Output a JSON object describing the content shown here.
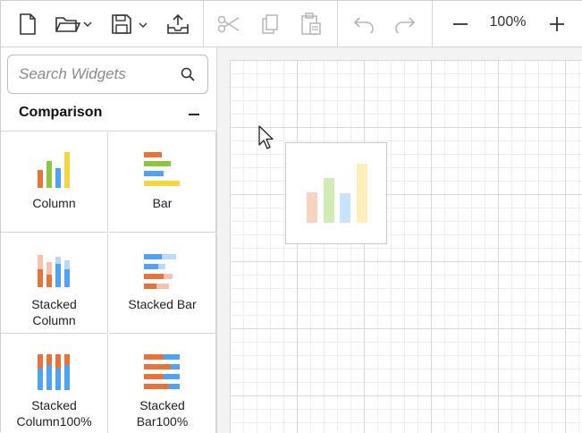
{
  "toolbar": {
    "zoom_value": "100%",
    "icons": [
      "new-file-icon",
      "open-folder-icon",
      "save-icon",
      "export-icon",
      "cut-icon",
      "copy-icon",
      "paste-icon",
      "undo-icon",
      "redo-icon",
      "zoom-out-icon",
      "zoom-in-icon"
    ]
  },
  "palette": {
    "search": {
      "placeholder": "Search Widgets"
    },
    "category": {
      "title": "Comparison"
    },
    "widgets": [
      {
        "label_line1": "Column",
        "label_line2": ""
      },
      {
        "label_line1": "Bar",
        "label_line2": ""
      },
      {
        "label_line1": "Stacked",
        "label_line2": "Column"
      },
      {
        "label_line1": "Stacked Bar",
        "label_line2": ""
      },
      {
        "label_line1": "Stacked",
        "label_line2": "Column100%"
      },
      {
        "label_line1": "Stacked",
        "label_line2": "Bar100%"
      }
    ]
  },
  "colors": {
    "orange": "#e8733a",
    "green": "#8cc63f",
    "blue": "#4fa3f7",
    "yellow": "#f5d63d",
    "grid_major": "#d9d9d9",
    "grid_minor": "#eeeeee"
  }
}
